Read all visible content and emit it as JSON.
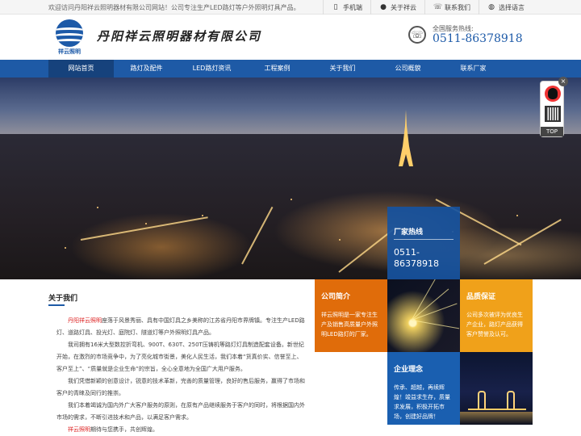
{
  "topbar": {
    "welcome": "欢迎访问丹阳祥云照明器材有限公司网站！公司专注生产LED路灯等户外照明灯具产品。",
    "links": [
      {
        "label": "手机端",
        "icon": "mobile-icon"
      },
      {
        "label": "关于祥云",
        "icon": "users-icon"
      },
      {
        "label": "联系我们",
        "icon": "phone-icon"
      },
      {
        "label": "选择语言",
        "icon": "globe-icon"
      }
    ]
  },
  "header": {
    "logo_text": "祥云照明",
    "company_name": "丹阳祥云照明器材有限公司",
    "hotline_label": "全国服务热线:",
    "hotline_number": "0511-86378918"
  },
  "nav": {
    "items": [
      "网站首页",
      "路灯及配件",
      "LED路灯资讯",
      "工程案例",
      "关于我们",
      "公司概貌",
      "联系厂家"
    ]
  },
  "side": {
    "close": "×",
    "top": "TOP"
  },
  "about": {
    "title": "关于我们",
    "highlight": "丹阳祥云照明",
    "p1_rest": "座落于风景秀丽、具有中国灯具之乡美称的江苏省丹阳市界牌镇。专注生产LED路灯、道路灯具、投光灯、庭院灯、隧道灯等户外照明灯具产品。",
    "p2": "我司拥有16米大型数控折弯机、900T、630T、250T压铸机等路灯灯具制造配套设备。新世纪开始，在激烈的市场竞争中，为了亮化城市街景，美化人民生活，我们本着“货真价实、信誉至上、客户至上”、“质量就是企业生命”的宗旨，全心全意地为全国广大用户服务。",
    "p3": "我们凭借新颖的创意设计，锐意的技术革新，完善的质量管理，良好的售后服务，赢得了市场和客户的青睐及同行的推崇。",
    "p4": "我们本着竭诚为国内外广大客户服务的原则，在原有产品继续服务于客户的同时，将根据国内外市场的需求，不断引进技术和产品，以满足客户需求。",
    "p5_highlight": "祥云照明",
    "p5_rest": "期待与您携手，共创辉煌。"
  },
  "hotline_box": {
    "title": "厂家热线",
    "number": "0511-86378918"
  },
  "tiles": {
    "intro": {
      "title": "公司简介",
      "text": "祥云照明是一家专注生产及销售高质量户外照明LED路灯的厂家。"
    },
    "quality": {
      "title": "品质保证",
      "text": "公司多次被评为优良生产企业，路灯产品获得客户赞誉及认可。"
    },
    "concept": {
      "title": "企业理念",
      "text": "传承、超越，再续辉煌！竣益求生存，质量求发展，积极开拓市场，创建好品牌！"
    }
  },
  "colors": {
    "brand_blue": "#1e5aa6",
    "orange": "#e06c0a",
    "gold": "#f0a11a",
    "highlight_red": "#dd2222"
  }
}
